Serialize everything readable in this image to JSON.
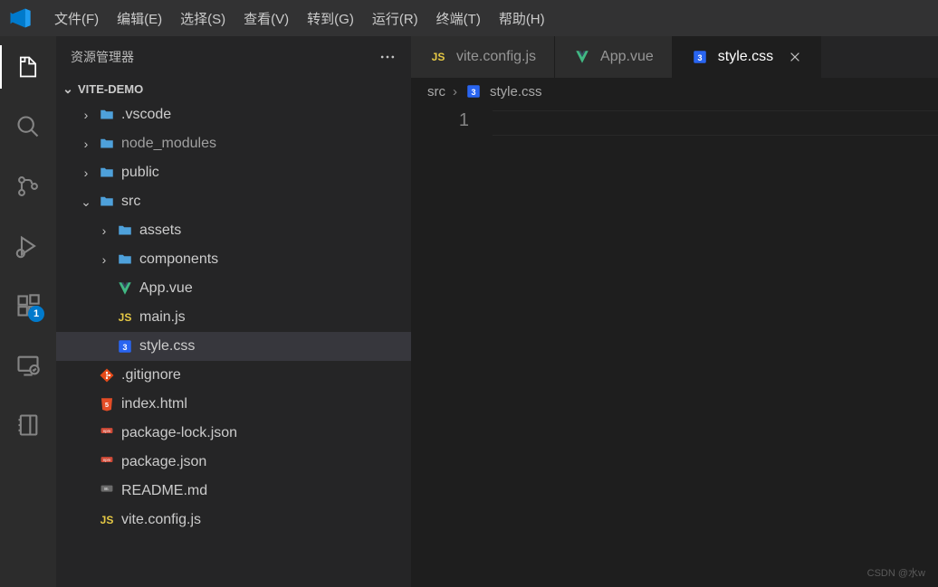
{
  "menu": [
    "文件(F)",
    "编辑(E)",
    "选择(S)",
    "查看(V)",
    "转到(G)",
    "运行(R)",
    "终端(T)",
    "帮助(H)"
  ],
  "activity": {
    "extensions_badge": "1"
  },
  "sidebar": {
    "title": "资源管理器",
    "project": "VITE-DEMO",
    "tree": [
      {
        "label": ".vscode",
        "type": "folder",
        "depth": 0,
        "expanded": false
      },
      {
        "label": "node_modules",
        "type": "folder",
        "depth": 0,
        "expanded": false,
        "dim": true
      },
      {
        "label": "public",
        "type": "folder",
        "depth": 0,
        "expanded": false
      },
      {
        "label": "src",
        "type": "folder",
        "depth": 0,
        "expanded": true
      },
      {
        "label": "assets",
        "type": "folder",
        "depth": 1,
        "expanded": false
      },
      {
        "label": "components",
        "type": "folder",
        "depth": 1,
        "expanded": false
      },
      {
        "label": "App.vue",
        "type": "vue",
        "depth": 1
      },
      {
        "label": "main.js",
        "type": "js",
        "depth": 1
      },
      {
        "label": "style.css",
        "type": "css",
        "depth": 1,
        "selected": true
      },
      {
        "label": ".gitignore",
        "type": "git",
        "depth": 0
      },
      {
        "label": "index.html",
        "type": "html",
        "depth": 0
      },
      {
        "label": "package-lock.json",
        "type": "json",
        "depth": 0
      },
      {
        "label": "package.json",
        "type": "json",
        "depth": 0
      },
      {
        "label": "README.md",
        "type": "md",
        "depth": 0
      },
      {
        "label": "vite.config.js",
        "type": "js",
        "depth": 0
      }
    ]
  },
  "tabs": [
    {
      "label": "vite.config.js",
      "icon": "js",
      "active": false
    },
    {
      "label": "App.vue",
      "icon": "vue",
      "active": false
    },
    {
      "label": "style.css",
      "icon": "css",
      "active": true
    }
  ],
  "breadcrumb": {
    "folder": "src",
    "file": "style.css",
    "icon": "css"
  },
  "editor": {
    "line_number": "1"
  },
  "watermark": "CSDN @水w"
}
